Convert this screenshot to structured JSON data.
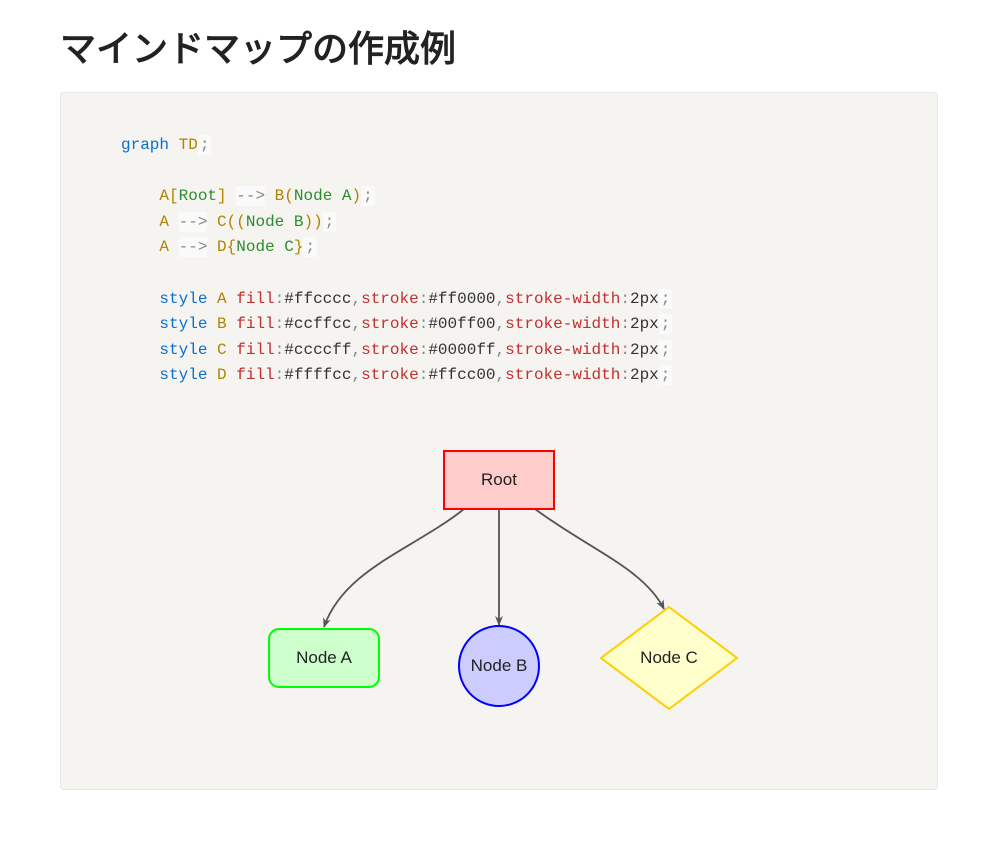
{
  "title": "マインドマップの作成例",
  "code": {
    "l0": {
      "kw": "graph",
      "arg": "TD"
    },
    "l1": {
      "a": "A",
      "b1": "[",
      "txt": "Root",
      "b2": "]",
      "arr": "-->",
      "c": "B",
      "p1": "(",
      "ctx": "Node A",
      "p2": ")"
    },
    "l2": {
      "a": "A",
      "arr": "-->",
      "c": "C",
      "p1": "((",
      "ctx": "Node B",
      "p2": "))"
    },
    "l3": {
      "a": "A",
      "arr": "-->",
      "c": "D",
      "p1": "{",
      "ctx": "Node C",
      "p2": "}"
    },
    "s1": {
      "kw": "style",
      "id": "A",
      "fill": "fill",
      "fv": "#ffcccc",
      "stroke": "stroke",
      "sv": "#ff0000",
      "sw": "stroke-width",
      "swv": "2px"
    },
    "s2": {
      "kw": "style",
      "id": "B",
      "fill": "fill",
      "fv": "#ccffcc",
      "stroke": "stroke",
      "sv": "#00ff00",
      "sw": "stroke-width",
      "swv": "2px"
    },
    "s3": {
      "kw": "style",
      "id": "C",
      "fill": "fill",
      "fv": "#ccccff",
      "stroke": "stroke",
      "sv": "#0000ff",
      "sw": "stroke-width",
      "swv": "2px"
    },
    "s4": {
      "kw": "style",
      "id": "D",
      "fill": "fill",
      "fv": "#ffffcc",
      "stroke": "stroke",
      "sv": "#ffcc00",
      "sw": "stroke-width",
      "swv": "2px"
    }
  },
  "chart_data": {
    "type": "diagram",
    "direction": "TD",
    "nodes": [
      {
        "id": "A",
        "label": "Root",
        "shape": "rect",
        "fill": "#ffcccc",
        "stroke": "#ff0000",
        "stroke_width": 2
      },
      {
        "id": "B",
        "label": "Node A",
        "shape": "round",
        "fill": "#ccffcc",
        "stroke": "#00ff00",
        "stroke_width": 2
      },
      {
        "id": "C",
        "label": "Node B",
        "shape": "circle",
        "fill": "#ccccff",
        "stroke": "#0000ff",
        "stroke_width": 2
      },
      {
        "id": "D",
        "label": "Node C",
        "shape": "diamond",
        "fill": "#ffffcc",
        "stroke": "#ffcc00",
        "stroke_width": 2
      }
    ],
    "edges": [
      {
        "from": "A",
        "to": "B"
      },
      {
        "from": "A",
        "to": "C"
      },
      {
        "from": "A",
        "to": "D"
      }
    ]
  }
}
